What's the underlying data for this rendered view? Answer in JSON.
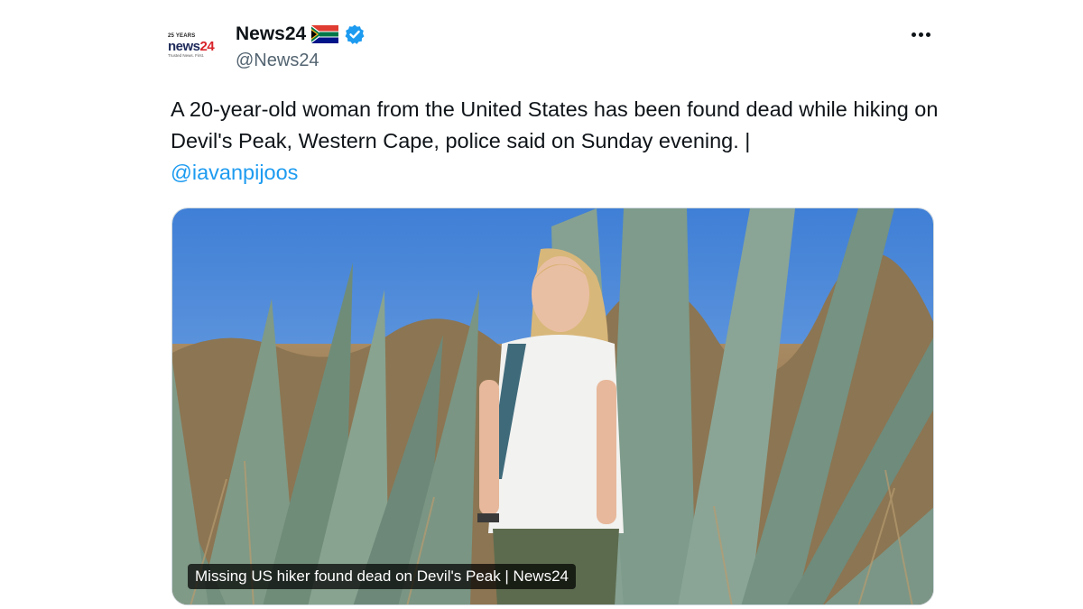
{
  "account": {
    "avatar": {
      "years_text": "25 YEARS",
      "brand_news": "news",
      "brand_num": "24",
      "tagline": "Trusted News. First."
    },
    "display_name": "News24",
    "handle": "@News24",
    "verified": true,
    "flag": "south-africa-flag-icon"
  },
  "tweet": {
    "text": "A 20-year-old woman from the United States has been found dead while hiking on Devil's Peak, Western Cape, police said on Sunday evening. | ",
    "mention": "@iavanpijoos"
  },
  "media": {
    "caption": "Missing US hiker found dead on Devil's Peak | News24",
    "description_icon": "hiker-photo"
  },
  "colors": {
    "accent": "#1d9bf0",
    "text": "#0f1419",
    "secondary": "#536471"
  }
}
